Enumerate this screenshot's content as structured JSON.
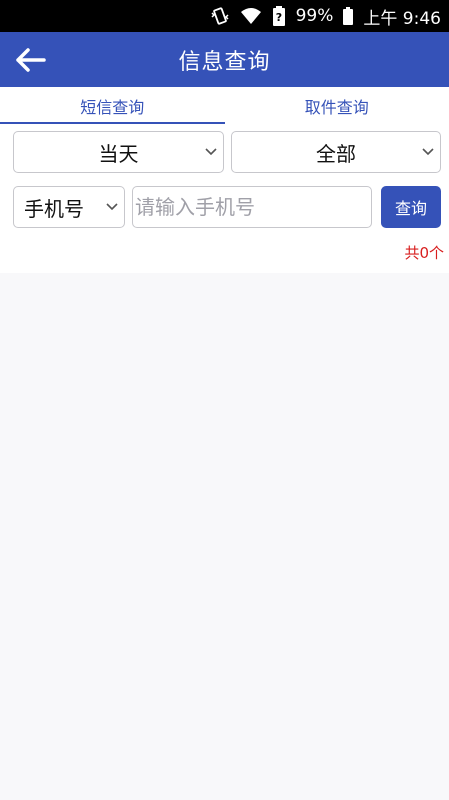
{
  "status_bar": {
    "battery_percent": "99%",
    "time": "上午 9:46",
    "icons": [
      "vibrate-icon",
      "wifi-icon",
      "battery-icon"
    ]
  },
  "header": {
    "title": "信息查询",
    "back_icon": "arrow-left-icon"
  },
  "tabs": [
    {
      "label": "短信查询",
      "active": true
    },
    {
      "label": "取件查询",
      "active": false
    }
  ],
  "filters": {
    "date_select": {
      "value": "当天"
    },
    "type_select": {
      "value": "全部"
    },
    "search_type_select": {
      "value": "手机号"
    },
    "search_input": {
      "value": "",
      "placeholder": "请输入手机号"
    },
    "query_button": "查询"
  },
  "result_count": "共0个",
  "colors": {
    "primary": "#3552b8",
    "count_text": "#d81e1e",
    "background": "#f8f8fa"
  }
}
